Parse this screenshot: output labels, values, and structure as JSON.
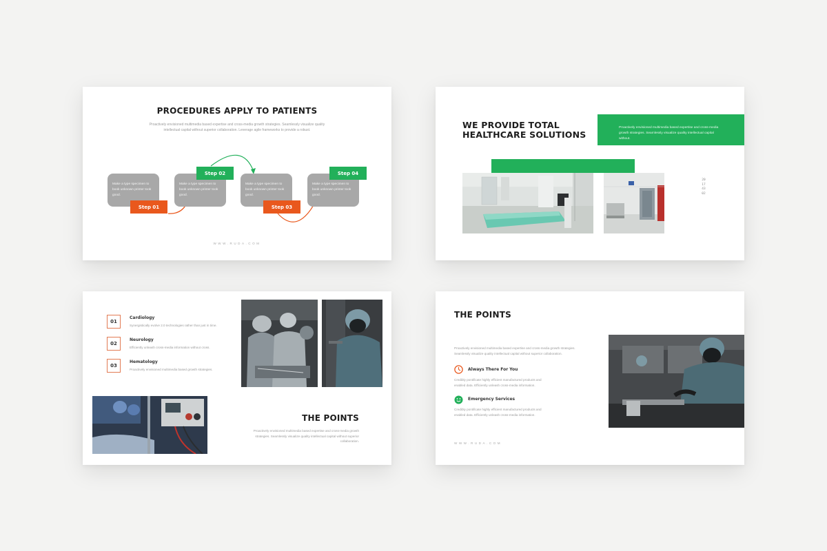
{
  "slide1": {
    "title": "PROCEDURES APPLY TO PATIENTS",
    "body": "Proactively envisioned multimedia based expertise and cross-media growth strategies. Seamlessly visualize quality intellectual capital without superior collaboration. Leverage agile frameworks to provide a robust.",
    "card_text": "Make a type specimen to book unknown printer took good.",
    "steps": [
      "Step 01",
      "Step 02",
      "Step 03",
      "Step 04"
    ],
    "footer": "WWW.RUDA.COM",
    "colors": {
      "orange": "#e9581d",
      "green": "#22b05a",
      "card": "#a8a8a8"
    }
  },
  "slide2": {
    "title_line1": "WE PROVIDE TOTAL",
    "title_line2": "HEALTHCARE SOLUTIONS",
    "green_box_text": "Proactively envisioned multimedia based expertise and cross-media growth strategies. Seamlessly visualize quality intellectual capital without.",
    "vertical_text": "20174302",
    "images": [
      "hospital-ward-photo",
      "hospital-corridor-photo"
    ]
  },
  "slide3": {
    "items": [
      {
        "num": "01",
        "title": "Cardiology",
        "desc": "Synergistically evolve 2.0 technologies rather than just in time."
      },
      {
        "num": "02",
        "title": "Neurology",
        "desc": "Efficiently unleash cross-media information without cross."
      },
      {
        "num": "03",
        "title": "Hematology",
        "desc": "Proactively envisioned multimedia based growth strategies."
      }
    ],
    "title": "THE POINTS",
    "body": "Proactively envisioned multimedia based expertise and cross-media growth strategies. Seamlessly visualize quality intellectual capital without superior collaboration.",
    "images": [
      "surgeons-operating-photo",
      "surgeon-portrait-photo",
      "patient-equipment-photo"
    ]
  },
  "slide4": {
    "title": "THE POINTS",
    "intro": "Proactively envisioned multimedia based expertise and cross-media growth strategies. Seamlessly visualize quality intellectual capital without superior collaboration.",
    "features": [
      {
        "icon": "clock-icon",
        "title": "Always There For You",
        "desc": "Credibly pontificate highly efficient manufactured products and enabled data. Efficiently unleash cross-media information."
      },
      {
        "icon": "smile-icon",
        "title": "Emergency Services",
        "desc": "Credibly pontificate highly efficient manufactured products and enabled data. Efficiently unleash cross-media information."
      }
    ],
    "footer": "WWW.RUDA.COM",
    "image": "surgeon-washing-hands-photo"
  }
}
